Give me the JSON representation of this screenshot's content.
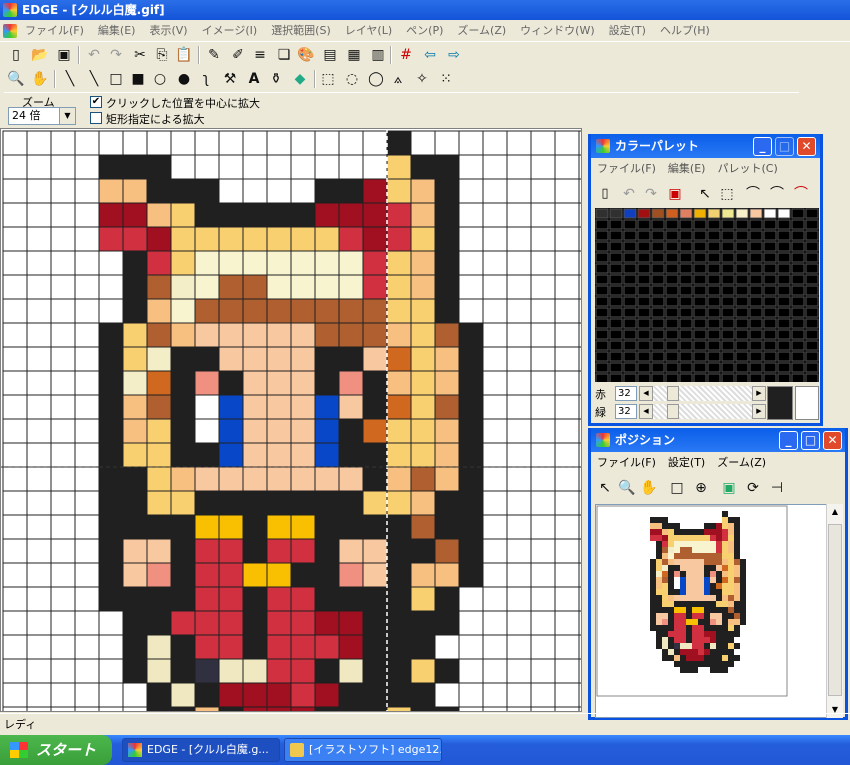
{
  "window": {
    "title": "EDGE - [クルル白魔.gif]"
  },
  "menu": [
    "ファイル(F)",
    "編集(E)",
    "表示(V)",
    "イメージ(I)",
    "選択範囲(S)",
    "レイヤ(L)",
    "ペン(P)",
    "ズーム(Z)",
    "ウィンドウ(W)",
    "設定(T)",
    "ヘルプ(H)"
  ],
  "toolbar1_icons": [
    "new-icon",
    "open-icon",
    "save-icon",
    "undo-icon",
    "redo-icon",
    "cut-icon",
    "copy-icon",
    "paste-icon",
    "pen-settings-icon",
    "brush-settings-icon",
    "line-width-icon",
    "layer-icon",
    "palette-icon",
    "film-icon",
    "preview-icon",
    "tile-icon",
    "grid-icon",
    "back-icon",
    "forward-icon"
  ],
  "toolbar2_icons": [
    "zoom-icon",
    "hand-icon",
    "pencil-icon",
    "line-icon",
    "rectangle-icon",
    "filled-rectangle-icon",
    "ellipse-icon",
    "filled-ellipse-icon",
    "curve-icon",
    "hammer-icon",
    "text-icon",
    "bucket-icon",
    "fill-icon",
    "rect-select-icon",
    "ellipse-select-icon",
    "lasso-icon",
    "polygon-select-icon",
    "magic-wand-icon",
    "move-select-icon"
  ],
  "zoom": {
    "label": "ズーム",
    "value": "24 倍",
    "opt_click_center": "クリックした位置を中心に拡大",
    "opt_click_center_checked": true,
    "opt_rect_zoom": "矩形指定による拡大",
    "opt_rect_zoom_checked": false
  },
  "status": "レディ",
  "taskbar": {
    "start": "スタート",
    "items": [
      "EDGE - [クルル白魔.g...",
      "[イラストソフト] edge12..."
    ]
  },
  "palette_window": {
    "title": "カラーパレット",
    "menu": [
      "ファイル(F)",
      "編集(E)",
      "パレット(C)"
    ],
    "colors": [
      "#303030",
      "#303030",
      "#1040c0",
      "#a01010",
      "#a05020",
      "#d06020",
      "#e08060",
      "#f0b000",
      "#f0d070",
      "#f0e890",
      "#f8f0c8",
      "#f8c8a0",
      "#ffffff",
      "#ffffff"
    ],
    "red_label": "赤",
    "red_value": "32",
    "green_label": "緑",
    "green_value": "32",
    "current_color": "#202020"
  },
  "position_window": {
    "title": "ポジション",
    "menu": [
      "ファイル(F)",
      "設定(T)",
      "ズーム(Z)"
    ]
  },
  "pixel_art": {
    "palette": {
      ".": "#ffffff",
      "K": "#202020",
      "S": "#f8c080",
      "Y": "#f8d070",
      "R": "#d03040",
      "D": "#a01020",
      "P": "#f4eec8",
      "W": "#f8f4d0",
      "B": "#b06030",
      "N": "#d06820",
      "F": "#f8c8a0",
      "f": "#f09080",
      "L": "#0848c8",
      "E": "#ffffff",
      "G": "#f8c000",
      "V": "#303040",
      "C": "#f0e8c0"
    },
    "rows": [
      "................K.......",
      "....KKK.........YKK.....",
      "....SSKKK....KKDYSK.....",
      "....DDSYKKKKKDDDRSK.....",
      "....RRDYYYYYYYRDRYK.....",
      ".....KRYWWWWWWWRYSK.....",
      ".....KBPWBBWWWWRYSK.....",
      ".....KSWBBBBBBBBYYK.....",
      "....KYBSFFFFFBBBSYBK....",
      "....KYPKKFFFFKKFNYSK....",
      "....KPNKfKFFFKfKSYSK....",
      "....KSBKELFFFLFKNYBK....",
      "....KSYKELFFFLKNYYSK....",
      "....KYYKKLFFFLKKYYSK....",
      "....KKYSFFFFFFFKSBSK....",
      "....KKYYKKKKKKKYYSKK....",
      "....KKKKGGKGGKKKKBKK....",
      "....KFFKRRKRRKFFKKBK....",
      "....KFfKRRGGKKfFKSSK....",
      "....KKKKRRKRRKKKKYK.....",
      ".....KKRRRKRRDDKKKK.....",
      ".....KCKRRKRRRDKKK......",
      ".....KCKVCCRRKCKKYK.....",
      "......KCKDDDRDKKKK......",
      "......KKSKDDDKKKYKK.....",
      "........KKKKKKKKKK......",
      ".........KKK..KKK......."
    ]
  }
}
